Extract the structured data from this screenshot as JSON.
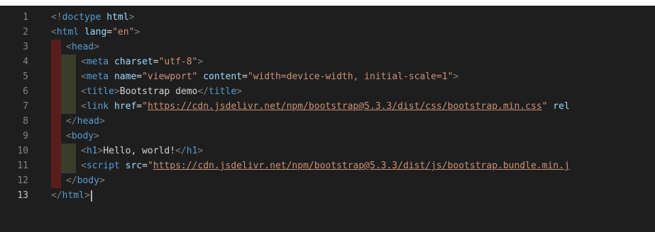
{
  "lines": [
    {
      "num": "1",
      "parts": [
        {
          "k": "p",
          "v": "<!"
        },
        {
          "k": "t",
          "v": "doctype"
        },
        {
          "k": "a",
          "v": " html"
        },
        {
          "k": "p",
          "v": ">"
        }
      ]
    },
    {
      "num": "2",
      "parts": [
        {
          "k": "p",
          "v": "<"
        },
        {
          "k": "t",
          "v": "html"
        },
        {
          "k": "a",
          "v": " lang"
        },
        {
          "k": "txt",
          "v": "="
        },
        {
          "k": "s",
          "v": "\"en\""
        },
        {
          "k": "p",
          "v": ">"
        }
      ]
    },
    {
      "num": "3",
      "parts": [
        {
          "k": "p",
          "v": "<"
        },
        {
          "k": "t",
          "v": "head"
        },
        {
          "k": "p",
          "v": ">"
        }
      ]
    },
    {
      "num": "4",
      "parts": [
        {
          "k": "p",
          "v": "<"
        },
        {
          "k": "t",
          "v": "meta"
        },
        {
          "k": "a",
          "v": " charset"
        },
        {
          "k": "txt",
          "v": "="
        },
        {
          "k": "s",
          "v": "\"utf-8\""
        },
        {
          "k": "p",
          "v": ">"
        }
      ]
    },
    {
      "num": "5",
      "parts": [
        {
          "k": "p",
          "v": "<"
        },
        {
          "k": "t",
          "v": "meta"
        },
        {
          "k": "a",
          "v": " name"
        },
        {
          "k": "txt",
          "v": "="
        },
        {
          "k": "s",
          "v": "\"viewport\""
        },
        {
          "k": "a",
          "v": " content"
        },
        {
          "k": "txt",
          "v": "="
        },
        {
          "k": "s",
          "v": "\"width=device-width, initial-scale=1\""
        },
        {
          "k": "p",
          "v": ">"
        }
      ]
    },
    {
      "num": "6",
      "parts": [
        {
          "k": "p",
          "v": "<"
        },
        {
          "k": "t",
          "v": "title"
        },
        {
          "k": "p",
          "v": ">"
        },
        {
          "k": "txt",
          "v": "Bootstrap demo"
        },
        {
          "k": "p",
          "v": "</"
        },
        {
          "k": "t",
          "v": "title"
        },
        {
          "k": "p",
          "v": ">"
        }
      ]
    },
    {
      "num": "7",
      "parts": [
        {
          "k": "p",
          "v": "<"
        },
        {
          "k": "t",
          "v": "link"
        },
        {
          "k": "a",
          "v": " href"
        },
        {
          "k": "txt",
          "v": "="
        },
        {
          "k": "s",
          "v": "\""
        },
        {
          "k": "u",
          "v": "https://cdn.jsdelivr.net/npm/bootstrap@5.3.3/dist/css/bootstrap.min.css"
        },
        {
          "k": "s",
          "v": "\""
        },
        {
          "k": "a",
          "v": " rel"
        }
      ]
    },
    {
      "num": "8",
      "parts": [
        {
          "k": "p",
          "v": "</"
        },
        {
          "k": "t",
          "v": "head"
        },
        {
          "k": "p",
          "v": ">"
        }
      ]
    },
    {
      "num": "9",
      "parts": [
        {
          "k": "p",
          "v": "<"
        },
        {
          "k": "t",
          "v": "body"
        },
        {
          "k": "p",
          "v": ">"
        }
      ]
    },
    {
      "num": "10",
      "parts": [
        {
          "k": "p",
          "v": "<"
        },
        {
          "k": "t",
          "v": "h1"
        },
        {
          "k": "p",
          "v": ">"
        },
        {
          "k": "txt",
          "v": "Hello, world!"
        },
        {
          "k": "p",
          "v": "</"
        },
        {
          "k": "t",
          "v": "h1"
        },
        {
          "k": "p",
          "v": ">"
        }
      ]
    },
    {
      "num": "11",
      "parts": [
        {
          "k": "p",
          "v": "<"
        },
        {
          "k": "t",
          "v": "script"
        },
        {
          "k": "a",
          "v": " src"
        },
        {
          "k": "txt",
          "v": "="
        },
        {
          "k": "s",
          "v": "\""
        },
        {
          "k": "u",
          "v": "https://cdn.jsdelivr.net/npm/bootstrap@5.3.3/dist/js/bootstrap.bundle.min.j"
        }
      ]
    },
    {
      "num": "12",
      "parts": [
        {
          "k": "p",
          "v": "</"
        },
        {
          "k": "t",
          "v": "body"
        },
        {
          "k": "p",
          "v": ">"
        }
      ]
    },
    {
      "num": "13",
      "parts": [
        {
          "k": "p",
          "v": "</"
        },
        {
          "k": "t",
          "v": "html"
        },
        {
          "k": "p",
          "v": ">"
        }
      ]
    }
  ],
  "active_line": "13"
}
